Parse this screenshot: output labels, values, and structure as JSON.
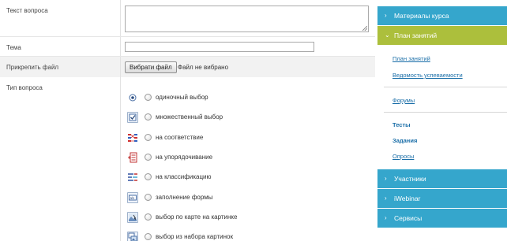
{
  "form": {
    "question_text": {
      "label": "Текст вопроса",
      "value": ""
    },
    "topic": {
      "label": "Тема",
      "value": ""
    },
    "attach_file": {
      "label": "Прикрепить файл",
      "button_label": "Вибрати файл",
      "status": "Файл не вибрано"
    },
    "question_type": {
      "label": "Тип вопроса",
      "options": [
        {
          "label": "одиночный выбор",
          "icon": "single-choice-icon"
        },
        {
          "label": "множественный выбор",
          "icon": "multiple-choice-icon"
        },
        {
          "label": "на соответствие",
          "icon": "matching-icon"
        },
        {
          "label": "на упорядочивание",
          "icon": "ordering-icon"
        },
        {
          "label": "на классификацию",
          "icon": "classification-icon"
        },
        {
          "label": "заполнение формы",
          "icon": "fill-form-icon"
        },
        {
          "label": "выбор по карте на картинке",
          "icon": "image-map-icon"
        },
        {
          "label": "выбор из набора картинок",
          "icon": "image-set-icon"
        }
      ]
    }
  },
  "sidebar": {
    "colors": {
      "blue": "#35a6cc",
      "green": "#acbf3c",
      "link": "#1a6ea8"
    },
    "sections": [
      {
        "label": "Материалы курса",
        "expanded": false
      },
      {
        "label": "План занятий",
        "expanded": true
      },
      {
        "label": "Участники",
        "expanded": false
      },
      {
        "label": "iWebinar",
        "expanded": false
      },
      {
        "label": "Сервисы",
        "expanded": false
      }
    ],
    "plan_links": {
      "plan": "План занятий",
      "gradebook": "Ведомость успеваемости",
      "forums": "Форумы",
      "tests": "Тесты",
      "assignments": "Задания",
      "polls": "Опросы"
    }
  }
}
